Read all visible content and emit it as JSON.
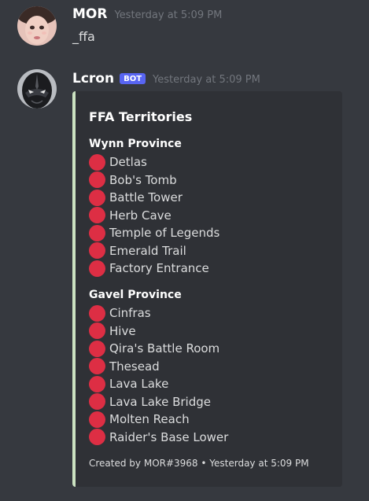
{
  "messages": [
    {
      "username": "MOR",
      "timestamp": "Yesterday at 5:09 PM",
      "content": "_ffa"
    },
    {
      "username": "Lcron",
      "bot_tag": "BOT",
      "timestamp": "Yesterday at 5:09 PM",
      "embed": {
        "title": "FFA Territories",
        "fields": [
          {
            "name": "Wynn Province",
            "items": [
              "Detlas",
              "Bob's Tomb",
              "Battle Tower",
              "Herb Cave",
              "Temple of Legends",
              "Emerald Trail",
              "Factory Entrance"
            ]
          },
          {
            "name": "Gavel Province",
            "items": [
              "Cinfras",
              "Hive",
              "Qira's Battle Room",
              "Thesead",
              "Lava Lake",
              "Lava Lake Bridge",
              "Molten Reach",
              "Raider's Base Lower"
            ]
          }
        ],
        "footer": "Created by MOR#3968 • Yesterday at 5:09 PM",
        "accent_color": "#cbe2c1",
        "dot_color": "#dd2e44",
        "dot_icon": "red-circle-icon"
      }
    }
  ],
  "colors": {
    "background": "#36393f",
    "embed_background": "#2f3136",
    "bot_tag": "#5865f2",
    "timestamp": "#72767d"
  }
}
